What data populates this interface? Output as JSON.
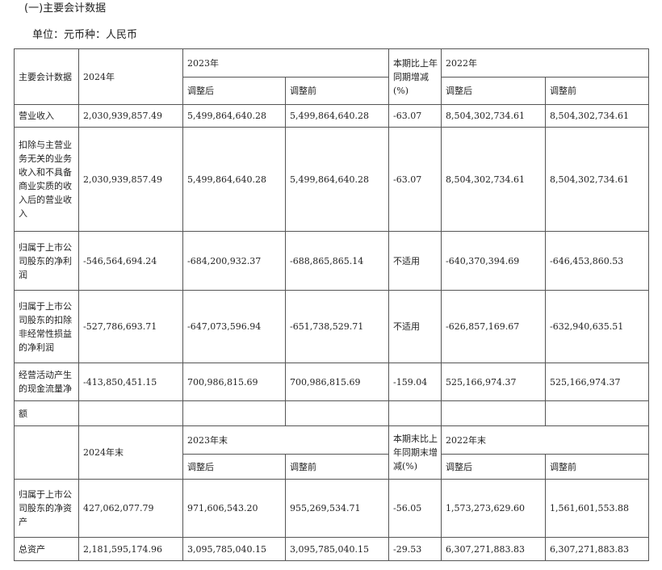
{
  "section_title": "(一)主要会计数据",
  "unit_line": "单位：元币种：人民币",
  "table1": {
    "header": {
      "item": "主要会计数据",
      "y2024": "2024年",
      "y2023": "2023年",
      "change": "本期比上年同期增减(%)",
      "y2022": "2022年",
      "adjusted": "调整后",
      "before": "调整前"
    },
    "rows": [
      {
        "label": "营业收入",
        "v2024": "2,030,939,857.49",
        "v2023a": "5,499,864,640.28",
        "v2023b": "5,499,864,640.28",
        "chg": "-63.07",
        "v2022a": "8,504,302,734.61",
        "v2022b": "8,504,302,734.61"
      },
      {
        "label": "扣除与主营业务无关的业务收入和不具备商业实质的收入后的营业收入",
        "v2024": "2,030,939,857.49",
        "v2023a": "5,499,864,640.28",
        "v2023b": "5,499,864,640.28",
        "chg": "-63.07",
        "v2022a": "8,504,302,734.61",
        "v2022b": "8,504,302,734.61"
      },
      {
        "label": "归属于上市公司股东的净利润",
        "v2024": "-546,564,694.24",
        "v2023a": "-684,200,932.37",
        "v2023b": "-688,865,865.14",
        "chg": "不适用",
        "v2022a": "-640,370,394.69",
        "v2022b": "-646,453,860.53"
      },
      {
        "label": "归属于上市公司股东的扣除非经常性损益的净利润",
        "v2024": "-527,786,693.71",
        "v2023a": "-647,073,596.94",
        "v2023b": "-651,738,529.71",
        "chg": "不适用",
        "v2022a": "-626,857,169.67",
        "v2022b": "-632,940,635.51"
      },
      {
        "label": "经营活动产生的现金流量净",
        "v2024": "-413,850,451.15",
        "v2023a": "700,986,815.69",
        "v2023b": "700,986,815.69",
        "chg": "-159.04",
        "v2022a": "525,166,974.37",
        "v2022b": "525,166,974.37"
      }
    ],
    "overflow_label": "额"
  },
  "table2": {
    "header": {
      "y2024": "2024年末",
      "y2023": "2023年末",
      "change": "本期末比上年同期末增减(%)",
      "y2022": "2022年末",
      "adjusted": "调整后",
      "before": "调整前"
    },
    "rows": [
      {
        "label": "归属于上市公司股东的净资产",
        "v2024": "427,062,077.79",
        "v2023a": "971,606,543.20",
        "v2023b": "955,269,534.71",
        "chg": "-56.05",
        "v2022a": "1,573,273,629.60",
        "v2022b": "1,561,601,553.88"
      },
      {
        "label": "总资产",
        "v2024": "2,181,595,174.96",
        "v2023a": "3,095,785,040.15",
        "v2023b": "3,095,785,040.15",
        "chg": "-29.53",
        "v2022a": "6,307,271,883.83",
        "v2022b": "6,307,271,883.83"
      }
    ]
  }
}
